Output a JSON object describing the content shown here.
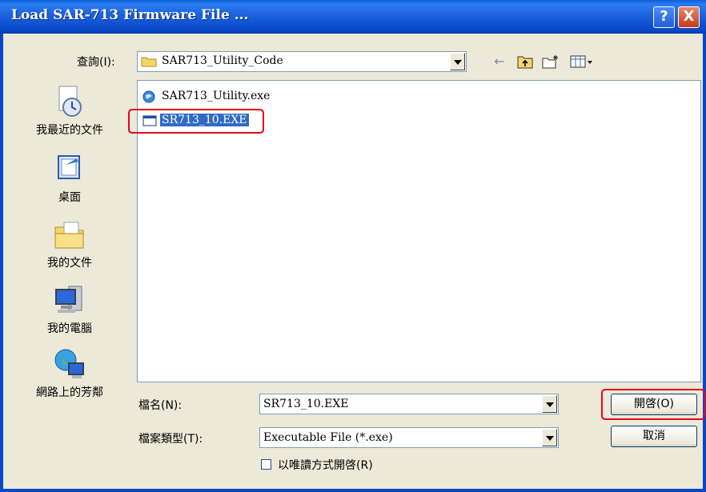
{
  "window": {
    "title": "Load SAR-713 Firmware File ...",
    "help_label": "?",
    "close_label": "X"
  },
  "lookin": {
    "label": "查詢(I):",
    "value": "SAR713_Utility_Code"
  },
  "toolbar": {
    "back_glyph": "←",
    "up_glyph": "⬆",
    "newfolder_glyph": "✱",
    "view_glyph": "▦"
  },
  "places": [
    {
      "label": "我最近的文件",
      "icon": "recent-documents-icon"
    },
    {
      "label": "桌面",
      "icon": "desktop-icon"
    },
    {
      "label": "我的文件",
      "icon": "my-documents-icon"
    },
    {
      "label": "我的電腦",
      "icon": "my-computer-icon"
    },
    {
      "label": "網路上的芳鄰",
      "icon": "network-places-icon"
    }
  ],
  "files": [
    {
      "name": "SAR713_Utility.exe",
      "icon": "executable-app-icon",
      "selected": false
    },
    {
      "name": "SR713_10.EXE",
      "icon": "executable-window-icon",
      "selected": true
    }
  ],
  "filename": {
    "label": "檔名(N):",
    "value": "SR713_10.EXE"
  },
  "filetype": {
    "label": "檔案類型(T):",
    "value": "Executable File (*.exe)"
  },
  "readonly": {
    "label": "以唯讀方式開啓(R)",
    "checked": false
  },
  "buttons": {
    "open": "開啓(O)",
    "cancel": "取消"
  },
  "colors": {
    "title_bar": "#0747c8",
    "highlight": "#e8001c",
    "selection": "#316ac5"
  }
}
